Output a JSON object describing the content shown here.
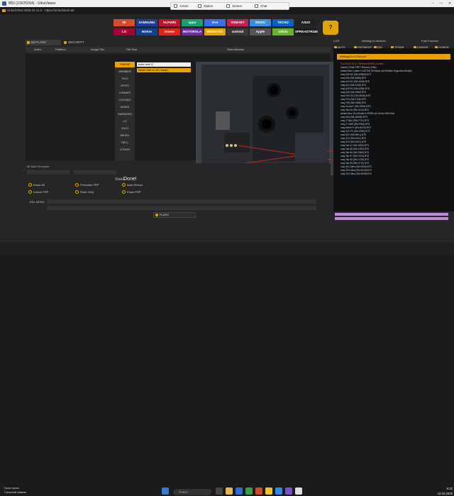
{
  "window": {
    "title": "MSI (216252S4) - UltraViewer",
    "controls": [
      "–",
      "□",
      "✕"
    ]
  },
  "app": {
    "title": "UnlockTool 2025.04.11.0 - https://unlocktool.net"
  },
  "remote_toolbar": {
    "items": [
      "Action",
      "Option",
      "Screen",
      "Chat"
    ]
  },
  "brands": [
    {
      "label": "MI",
      "color": "#d94a2a"
    },
    {
      "label": "SAMSUNG",
      "color": "#1b3f9a"
    },
    {
      "label": "HUAWEI",
      "color": "#c8102e"
    },
    {
      "label": "oppo",
      "color": "#1aa06b"
    },
    {
      "label": "vivo",
      "color": "#3a6ee8"
    },
    {
      "label": "VSMART",
      "color": "#c81e50"
    },
    {
      "label": "MEIZU",
      "color": "#3a8fe0"
    },
    {
      "label": "TECNO",
      "color": "#0a5fd0"
    },
    {
      "label": "ASUS",
      "color": "#222222"
    },
    {
      "label": "LG",
      "color": "#a50034"
    },
    {
      "label": "NOKIA",
      "color": "#124191"
    },
    {
      "label": "lenovo",
      "color": "#e2231a"
    },
    {
      "label": "MOTOROLA",
      "color": "#6b2fa0"
    },
    {
      "label": "MEDIATEK",
      "color": "#e5a100"
    },
    {
      "label": "android",
      "color": "#3a3a3a"
    },
    {
      "label": "Apple",
      "color": "#555555"
    },
    {
      "label": "infinix",
      "color": "#6bb12a"
    },
    {
      "label": "SPREADTRUM",
      "color": "#1e1e1e"
    }
  ],
  "tabs": [
    {
      "label": "MI FLASH"
    },
    {
      "label": "SECURITY"
    }
  ],
  "table_headers": [
    "Index",
    "Partition",
    "Image File",
    "File Size",
    "Start Address"
  ],
  "phone_list": [
    "XIAOMI",
    "MEMBER",
    "VIVO",
    "OPPO",
    "VSMART",
    "LOVONG",
    "NOKIA",
    "SAMSUNG",
    "LG",
    "IOLIO",
    "MEIZU",
    "DELL",
    "OTHER"
  ],
  "model": {
    "input": "redmi note 12",
    "selected": "Redmi Note 12 4G (Topaz)"
  },
  "right": {
    "top_left": "LOG",
    "waiting_for_devices": "Waiting for devices",
    "fast_connect": "Fast Connect",
    "buttons": [
      "AUTO",
      "FASTBOOT",
      "EDL",
      "TPOINT",
      "DIVIDER",
      "CONFIG"
    ],
    "waiting": "Waiting for COM port",
    "log_lines": [
      "Tool 2025.04.11.0 Released(NEW) Update !",
      "Xiaomi [ Flash FRP / Reboot ] Flash",
      "Added New Loader CUSTOM ON Block via Redfirmi Supported Models",
      "umq A05 5G (SM-A0565) BTS",
      "umq A06 (SM-A065) BTS",
      "umq A15 5G (SM-A156) BTS",
      "umq A16 (SM-A165) BTS",
      "umq A25 5G (SM-A256) BTS",
      "umq A35 (SM-A356) BTS",
      "umq M15 5G (SM-M156) BTS",
      "umq F15 (SM-F156) BTS",
      "umq F55 (SM-F556) BTS",
      "umq Xcover7 (SM-G556) BTS",
      "umq Tab A9 (SM-X110) BTS",
      "Added New Vivo Model in FRRR via Online USB Boot",
      "umq A54 (SM-A546E) BTS",
      "umq Z Flip4 (SM-F721) BTS",
      "umq Z Fold5 (SM-F946) BTS",
      "umq Note10+ (SM-N976) BTS",
      "umq S21 FE (SM-G990) BTS",
      "umq S22 (SM-S901) BTS",
      "umq S23 (SM-S911) BTS",
      "umq S24 (SM-S921) BTS",
      "umq Tab A7 (SM-T500) BTS",
      "umq Tab A8 (SM-X200) BTS",
      "umq Tab S6 (SM-T860) BTS",
      "umq Tab S7 (SM-T870) BTS",
      "umq Tab S8 (SM-X700) BTS",
      "umq Tab S9 (SM-X710) BTS",
      "umq S22 Ultra (SM-S908) BTS",
      "umq S23 Ultra (SM-S918) BTS",
      "umq S24 Ultra (SM-S928) BTS"
    ]
  },
  "bottom": {
    "status_label": "Status",
    "status_value": "Done!",
    "firmware_label": "Mi flash Firmware",
    "checkboxes": [
      "Erase All",
      "Preloader FRP",
      "Auto Reboot",
      "Unlock FRP",
      "Flash Only",
      "Erase FRP"
    ],
    "edl_label": "EDL MODE",
    "flash_button": "FLASH"
  },
  "taskbar": {
    "search_placeholder": "Поиск",
    "weather_temp": "Гром грозы",
    "weather_sub": "Сильный ливень",
    "time": "6:42",
    "date": "12.04.2025"
  }
}
